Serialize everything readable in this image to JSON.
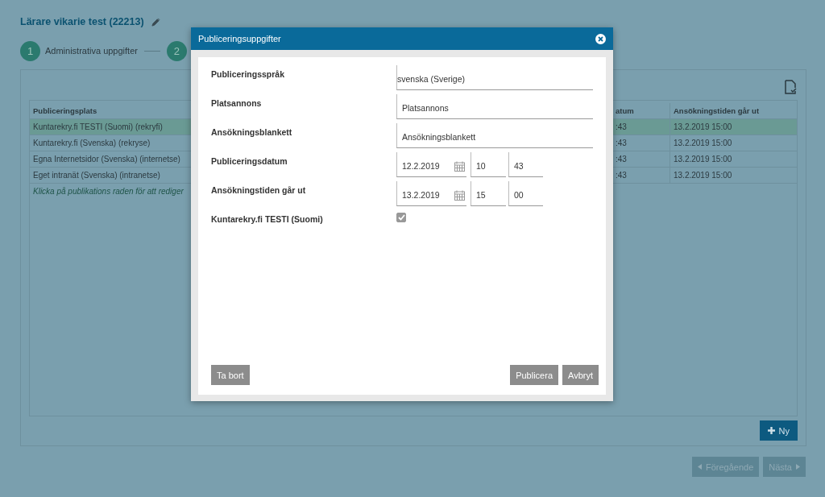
{
  "page": {
    "title": "Lärare vikarie test (22213)"
  },
  "steps": [
    {
      "number": "1",
      "label": "Administrativa uppgifter"
    },
    {
      "number": "2"
    }
  ],
  "table": {
    "columns": [
      "Publiceringsplats",
      "atum",
      "Ansökningstiden går ut"
    ],
    "rows": [
      {
        "cells": [
          "Kuntarekry.fi TESTI (Suomi) (rekryfi)",
          ":43",
          "13.2.2019 15:00"
        ],
        "selected": true
      },
      {
        "cells": [
          "Kuntarekry.fi (Svenska) (rekryse)",
          ":43",
          "13.2.2019 15:00"
        ],
        "selected": false
      },
      {
        "cells": [
          "Egna Internetsidor (Svenska) (internetse)",
          ":43",
          "13.2.2019 15:00"
        ],
        "selected": false
      },
      {
        "cells": [
          "Eget intranät (Svenska) (intranetse)",
          ":43",
          "13.2.2019 15:00"
        ],
        "selected": false
      }
    ],
    "hint": "Klicka på publikations raden för att rediger"
  },
  "new_button": "Ny",
  "nav": {
    "previous": "Föregående",
    "next": "Nästa"
  },
  "dialog": {
    "title": "Publiceringsuppgifter",
    "fields": [
      {
        "kind": "text",
        "label": "Publiceringsspråk",
        "value": "svenska (Sverige)"
      },
      {
        "kind": "text",
        "label": "Platsannons",
        "value": "Platsannons"
      },
      {
        "kind": "text",
        "label": "Ansökningsblankett",
        "value": "Ansökningsblankett"
      },
      {
        "kind": "datetime",
        "label": "Publiceringsdatum",
        "date": "12.2.2019",
        "hour": "10",
        "minute": "43"
      },
      {
        "kind": "datetime",
        "label": "Ansökningstiden går ut",
        "date": "13.2.2019",
        "hour": "15",
        "minute": "00"
      },
      {
        "kind": "checkbox",
        "label": "Kuntarekry.fi TESTI (Suomi)",
        "checked": true
      }
    ],
    "buttons": {
      "delete": "Ta bort",
      "publish": "Publicera",
      "cancel": "Avbryt"
    }
  }
}
